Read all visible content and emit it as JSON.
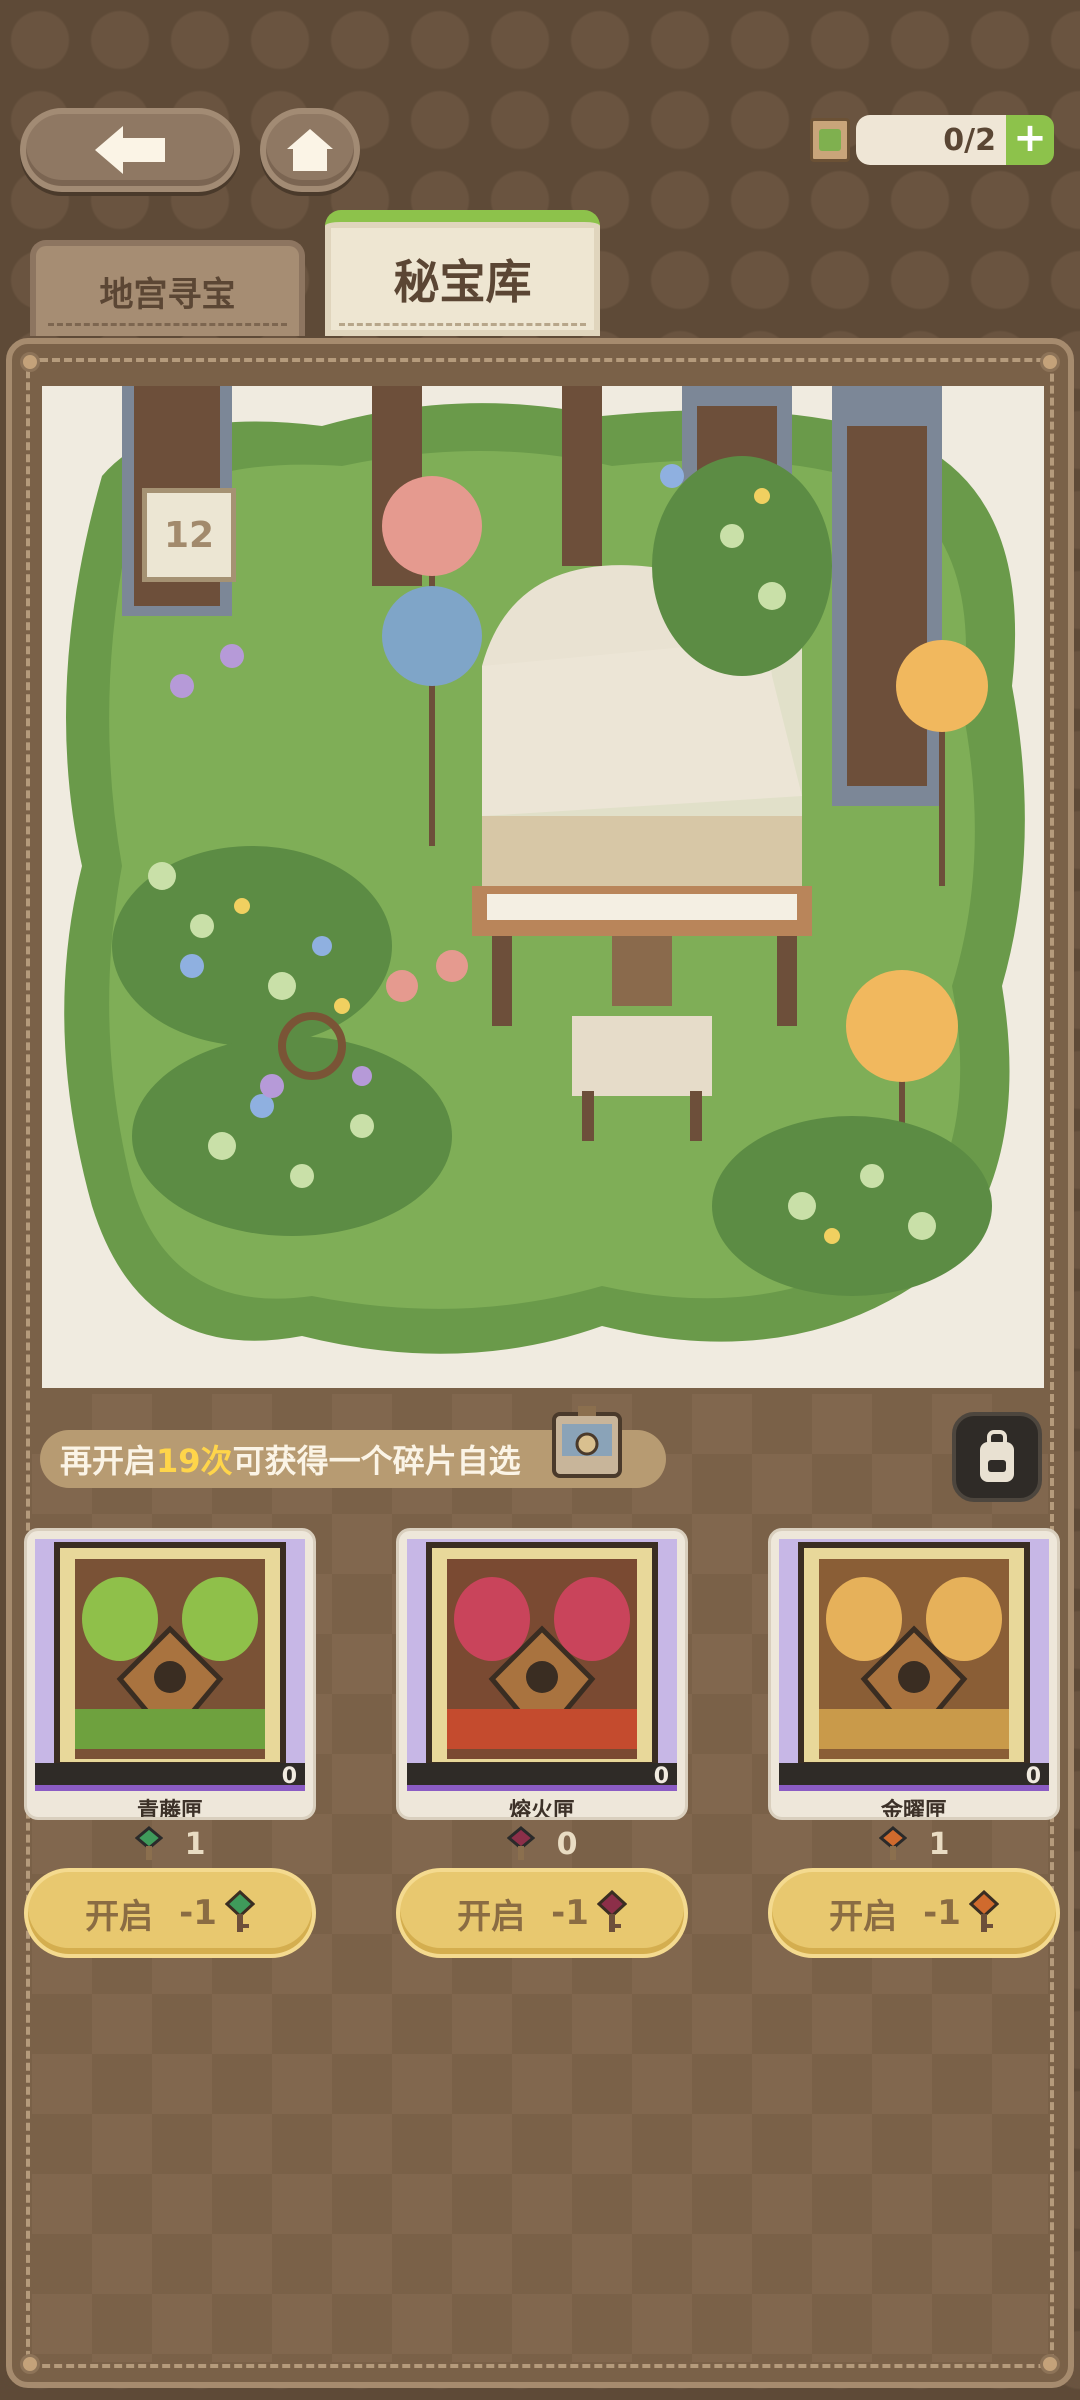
{
  "top_bar": {
    "key_counter": "0/2",
    "plus_label": "+"
  },
  "tabs": [
    {
      "label": "地宫寻宝",
      "active": false
    },
    {
      "label": "秘宝库",
      "active": true
    }
  ],
  "scene": {
    "door_number": "12"
  },
  "progress": {
    "prefix": "再开启",
    "count": "19次",
    "suffix": "可获得一个碎片自选"
  },
  "boxes": [
    {
      "name": "青藤匣",
      "count": "0",
      "keys": "1",
      "open_label": "开启",
      "cost": "-1",
      "color": "#8fc04a",
      "key_color": "#3f9b5b"
    },
    {
      "name": "熔火匣",
      "count": "0",
      "keys": "0",
      "open_label": "开启",
      "cost": "-1",
      "color": "#c9445b",
      "key_color": "#8c2f49"
    },
    {
      "name": "金曜匣",
      "count": "0",
      "keys": "1",
      "open_label": "开启",
      "cost": "-1",
      "color": "#e6b15a",
      "key_color": "#d06a2d"
    }
  ]
}
